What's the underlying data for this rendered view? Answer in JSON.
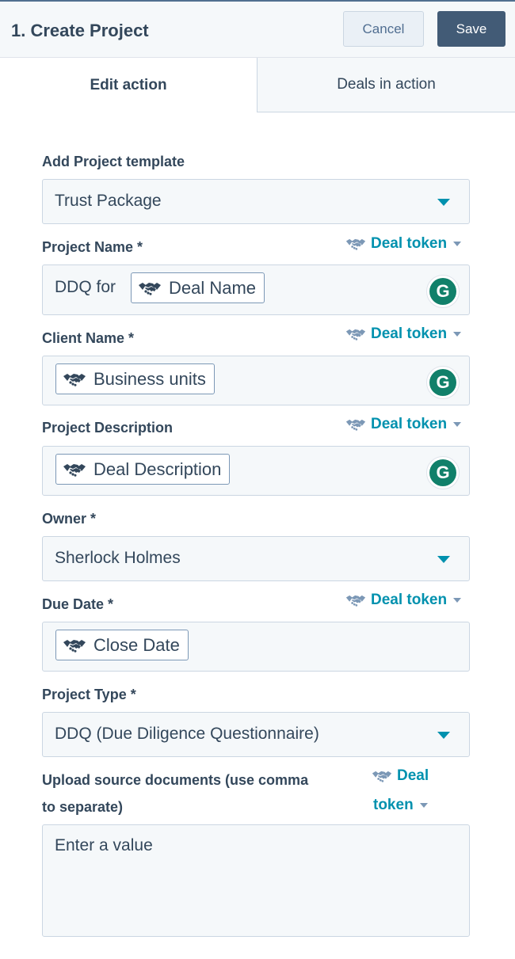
{
  "header": {
    "title": "1. Create Project",
    "cancel_label": "Cancel",
    "save_label": "Save"
  },
  "tabs": [
    {
      "label": "Edit action",
      "active": true
    },
    {
      "label": "Deals in action",
      "active": false
    }
  ],
  "token_link": {
    "label": "Deal token",
    "label_line1": "Deal",
    "label_line2": "token"
  },
  "fields": {
    "template": {
      "label": "Add Project template",
      "value": "Trust Package"
    },
    "project_name": {
      "label": "Project Name *",
      "prefix": "DDQ for",
      "token": "Deal Name"
    },
    "client_name": {
      "label": "Client Name *",
      "token": "Business units"
    },
    "project_description": {
      "label": "Project Description",
      "token": "Deal Description"
    },
    "owner": {
      "label": "Owner *",
      "value": "Sherlock Holmes"
    },
    "due_date": {
      "label": "Due Date *",
      "token": "Close Date"
    },
    "project_type": {
      "label": "Project Type *",
      "value": "DDQ (Due Diligence Questionnaire)"
    },
    "upload": {
      "label_line1": "Upload source documents (use comma",
      "label_line2": "to separate)",
      "placeholder": "Enter a value"
    }
  },
  "icons": {
    "grammarly": "G"
  },
  "colors": {
    "accent": "#0091ae",
    "save": "#425b76",
    "text": "#33475b"
  }
}
